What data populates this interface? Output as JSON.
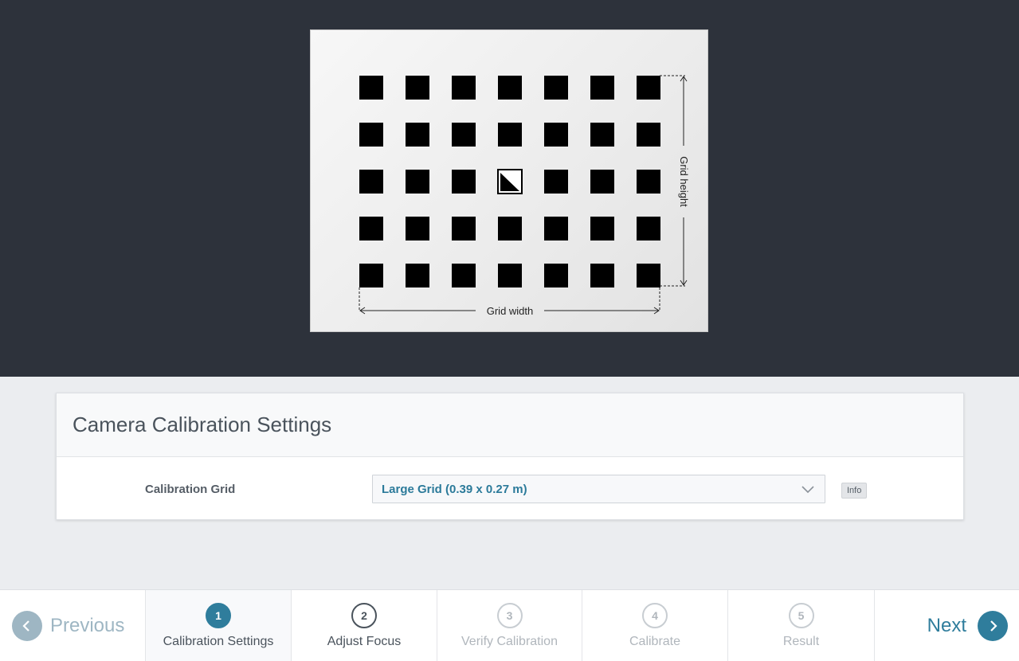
{
  "preview": {
    "grid_width_label": "Grid width",
    "grid_height_label": "Grid height",
    "grid": {
      "columns": 7,
      "rows": 5,
      "origin_marker": {
        "column": 4,
        "row": 3
      }
    }
  },
  "settings": {
    "title": "Camera Calibration Settings",
    "calibration_grid_label": "Calibration Grid",
    "calibration_grid_value": "Large Grid (0.39 x 0.27 m)",
    "info_label": "Info"
  },
  "wizard": {
    "previous_label": "Previous",
    "next_label": "Next",
    "steps": [
      {
        "number": "1",
        "label": "Calibration Settings",
        "state": "active"
      },
      {
        "number": "2",
        "label": "Adjust Focus",
        "state": "enabled"
      },
      {
        "number": "3",
        "label": "Verify Calibration",
        "state": "disabled"
      },
      {
        "number": "4",
        "label": "Calibrate",
        "state": "disabled"
      },
      {
        "number": "5",
        "label": "Result",
        "state": "disabled"
      }
    ]
  },
  "colors": {
    "preview_background": "#2d323b",
    "accent": "#2f7d9c",
    "disabled": "#b0b6bc"
  }
}
